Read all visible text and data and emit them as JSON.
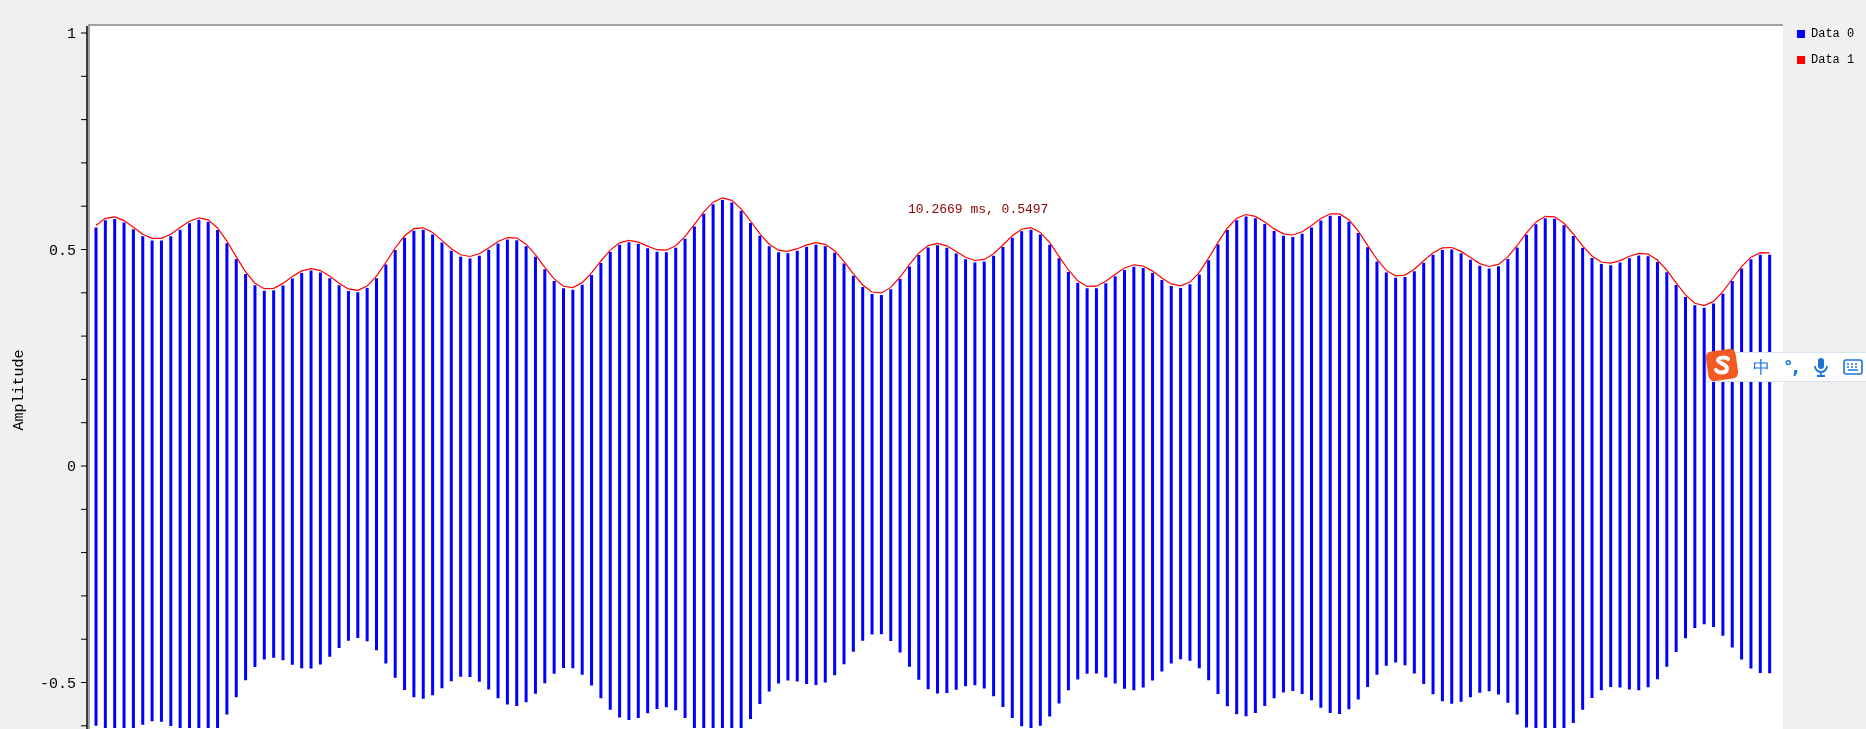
{
  "chart": {
    "y_axis": {
      "title": "Amplitude",
      "ticks": [
        "1",
        "0.5",
        "0",
        "-0.5"
      ]
    },
    "legend": [
      {
        "name": "Data 0",
        "color": "#0000ff"
      },
      {
        "name": "Data 1",
        "color": "#ff0000"
      }
    ],
    "annotation": "10.2669 ms, 0.5497"
  },
  "ime_toolbar": {
    "mode": "中",
    "punctuation": "°,"
  }
}
